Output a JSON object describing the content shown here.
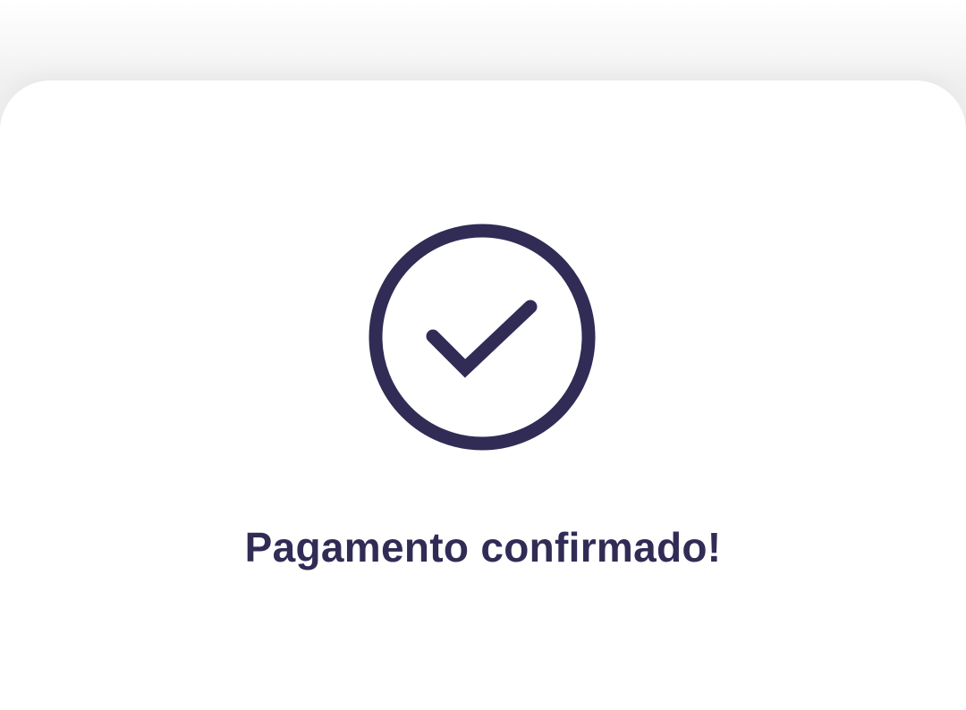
{
  "colors": {
    "accent": "#302c55",
    "sheet_background": "#ffffff",
    "page_background": "#f2f2f2"
  },
  "confirmation": {
    "icon": "check-circle-icon",
    "title": "Pagamento confirmado!"
  }
}
